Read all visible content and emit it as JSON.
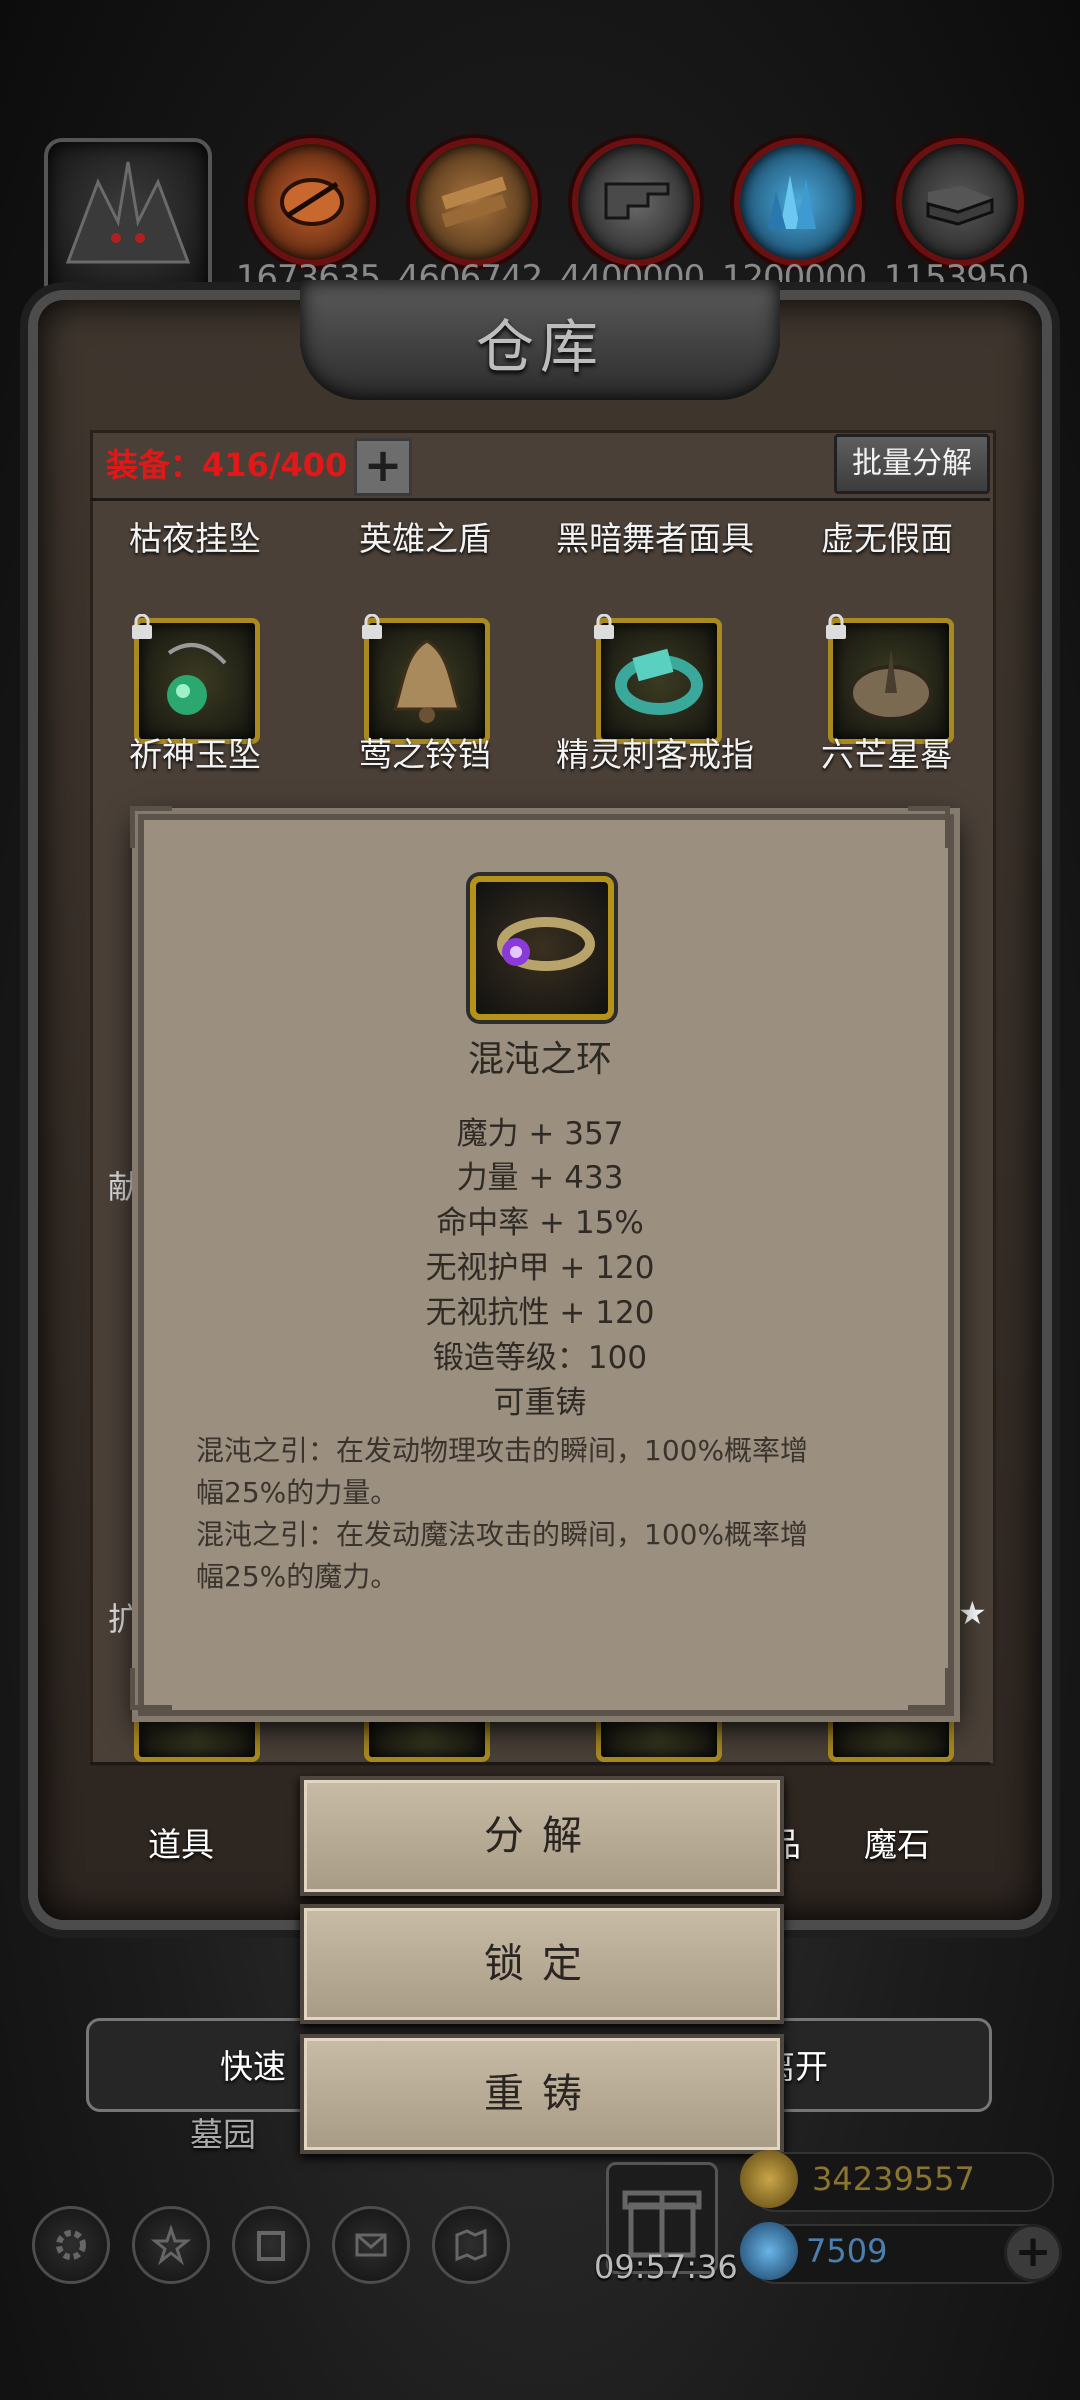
{
  "resources": {
    "counts": [
      "1673635",
      "4606742",
      "4400000",
      "1200000",
      "1153950"
    ],
    "icons": [
      "ore-icon",
      "wood-icon",
      "iron-icon",
      "crystal-icon",
      "steel-icon"
    ]
  },
  "warehouse": {
    "title": "仓库",
    "equip_label": "装备：",
    "equip_count": "416/400",
    "plus_label": "+",
    "batch_label": "批量分解"
  },
  "items": {
    "row1": [
      "枯夜挂坠",
      "英雄之盾",
      "黑暗舞者面具",
      "虚无假面"
    ],
    "row2": [
      "祈神玉坠",
      "莺之铃铛",
      "精灵刺客戒指",
      "六芒星晷"
    ]
  },
  "edge_text": {
    "left1": "献",
    "left2": "扩",
    "right_star": "★"
  },
  "popup": {
    "item_name": "混沌之环",
    "stats": [
      "魔力 + 357",
      "力量 + 433",
      "命中率 + 15%",
      "无视护甲 + 120",
      "无视抗性 + 120",
      "锻造等级：100",
      "可重铸"
    ],
    "desc": [
      "混沌之引：在发动物理攻击的瞬间，100%概率增",
      "幅25%的力量。",
      "混沌之引：在发动魔法攻击的瞬间，100%概率增",
      "幅25%的魔力。"
    ]
  },
  "actions": {
    "decompose": "分解",
    "lock": "锁定",
    "reforge": "重铸"
  },
  "tabs": {
    "left": "道具",
    "right": "魔石",
    "partial_right": "品"
  },
  "bottom": {
    "quick_label": "快速",
    "leave_label": "离开",
    "graveyard_label": "墓园",
    "timer": "09:57:36",
    "gold": "34239557",
    "gems": "7509",
    "gold_color": "#8a7430",
    "gem_color": "#4a7fb0"
  }
}
